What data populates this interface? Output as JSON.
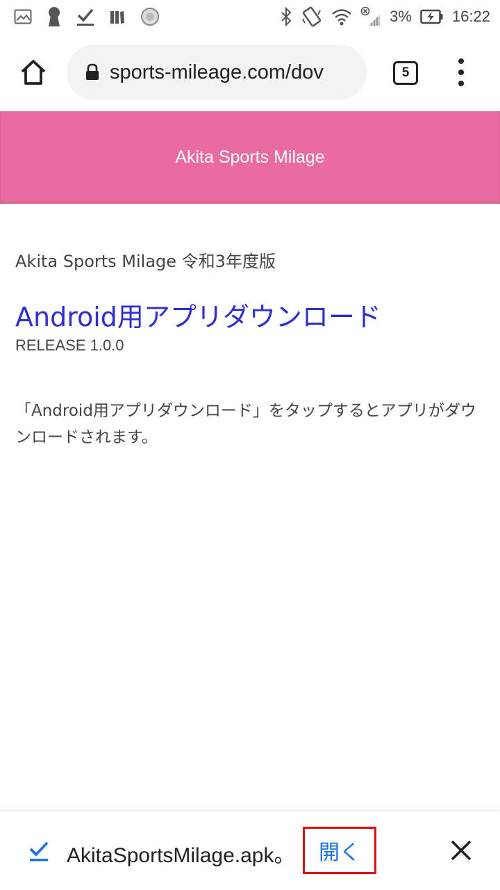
{
  "status_bar": {
    "battery_percent": "3%",
    "time": "16:22",
    "left_icons": [
      "image-icon",
      "keyhole-icon",
      "download-done-icon",
      "books-icon",
      "sync-circle-icon"
    ],
    "right_icons": [
      "bluetooth-icon",
      "vibrate-icon",
      "wifi-icon",
      "signal-off-icon",
      "battery-charging-icon"
    ]
  },
  "browser": {
    "url": "sports-mileage.com/dov",
    "tab_count": "5"
  },
  "site": {
    "header_title": "Akita Sports Milage",
    "header_color": "#e96b9f"
  },
  "content": {
    "subtitle": "Akita Sports Milage 令和3年度版",
    "download_link": "Android用アプリダウンロード",
    "release": "RELEASE 1.0.0",
    "instructions": "「Android用アプリダウンロード」をタップするとアプリがダウンロードされます。",
    "link_color": "#2f2fd0"
  },
  "download_bar": {
    "filename": "AkitaSportsMilage.apk。",
    "open_label": "開く"
  }
}
